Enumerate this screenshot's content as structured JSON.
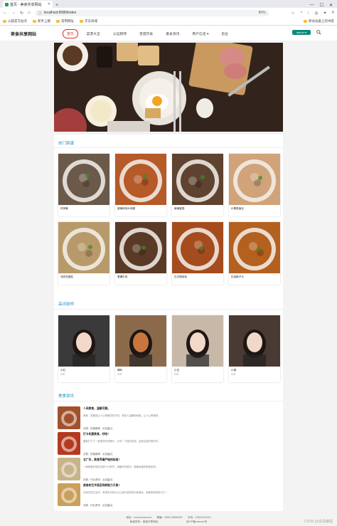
{
  "browser": {
    "tab_title": "首页 - 美食共享网站",
    "new_tab": "+",
    "url_secure": "ⓘ",
    "url": "localhost:8080/index",
    "zoom": "80%",
    "bookmarks": [
      "火狐官方站点",
      "新手上路",
      "常用网址",
      "京东商城"
    ],
    "bookmark_right": "移动设备上的书签",
    "win_min": "—",
    "win_max": "☐",
    "win_close": "✕"
  },
  "nav": {
    "logo": "美食共享网站",
    "items": [
      "首页",
      "菜谱大全",
      "认证厨师",
      "百搭饮食",
      "美食资讯",
      "用户信息 ▾",
      "后台"
    ],
    "login": "admin ▾"
  },
  "sections": {
    "hot": "热门菜谱",
    "chefs": "高评厨师",
    "news": "美食资讯"
  },
  "recipes": [
    {
      "name": "炸排骨",
      "color": "#6b5a4a"
    },
    {
      "name": "香辣鸡肉炒鸡翅",
      "color": "#b55a28"
    },
    {
      "name": "麻辣香锅",
      "color": "#5f4330"
    },
    {
      "name": "炒黑麦面丝",
      "color": "#d0a37a"
    },
    {
      "name": "凉拌豆腐粒",
      "color": "#b89a6a"
    },
    {
      "name": "葱爆牛肉",
      "color": "#5a3a26"
    },
    {
      "name": "日式照烧鸡",
      "color": "#a54c1e"
    },
    {
      "name": "红烧狮子头",
      "color": "#b4601f"
    }
  ],
  "chefs": [
    {
      "name": "小红",
      "score": "0.00",
      "color": "#3a3a3a"
    },
    {
      "name": "哪吒",
      "score": "0.00",
      "color": "#8b6a4c"
    },
    {
      "name": "小白",
      "score": "0.00",
      "color": "#c7b8a8"
    },
    {
      "name": "小美",
      "score": "0.00",
      "color": "#4a3a34"
    }
  ],
  "news": [
    {
      "title": "人间美食，温暖可期。",
      "desc": "美食，是最能让人心情愉悦的东西，带给人温暖和幸福，让人心情愉悦...",
      "meta": "分类：饮食新闻　点击量(1)",
      "color": "#a0522d"
    },
    {
      "title": "打卡实惠美食，好吃！",
      "desc": "最新打卡了一家很好吃的餐厅，分享一下我的经验，这家店真的很好吃...",
      "meta": "分类：饮食新闻　点击量(2)",
      "color": "#b5391f"
    },
    {
      "title": "北广东，美食界最严格的标准！",
      "desc": "一碗美食的制作过程十分考究，用最好的食材，做最地道的美食呈现...",
      "meta": "分类：行业资讯　点击量(3)",
      "color": "#c9b38a"
    },
    {
      "title": "美食和艺术是否同样致力于美?",
      "desc": "在我们的生活中，有很多东西可以让我们感到快乐和满足，而美食就是其中之一...",
      "meta": "分类：行业资讯　点击量(4)",
      "color": "#caa05a"
    }
  ],
  "footer": {
    "line1": "地址：xxxxxxxxxxxxxx　　邮编：0000-00000000　　手机：13512312312",
    "line2": "版权所有：美食共享网站　　　　　　　　　　　京ICP备xxxxxxx号"
  },
  "watermark": "CSDN @说说编程"
}
